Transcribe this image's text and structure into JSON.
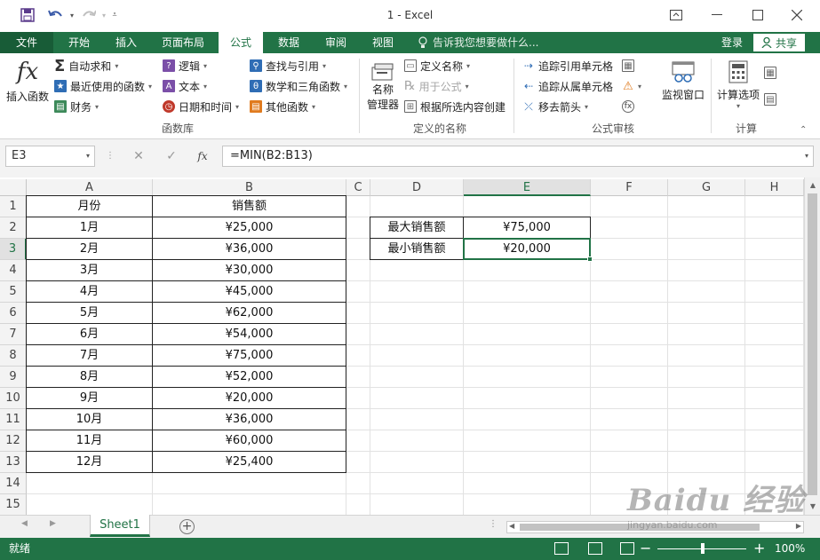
{
  "window": {
    "title": "1 - Excel",
    "controls": [
      "restore-ribbon",
      "minimize",
      "maximize",
      "close"
    ]
  },
  "tabs": [
    {
      "label": "文件",
      "active": false
    },
    {
      "label": "开始",
      "active": false
    },
    {
      "label": "插入",
      "active": false
    },
    {
      "label": "页面布局",
      "active": false
    },
    {
      "label": "公式",
      "active": true
    },
    {
      "label": "数据",
      "active": false
    },
    {
      "label": "审阅",
      "active": false
    },
    {
      "label": "视图",
      "active": false
    }
  ],
  "tell_me": "告诉我您想要做什么...",
  "login": "登录",
  "share": "共享",
  "ribbon": {
    "insert_function": "插入函数",
    "autosum": "自动求和",
    "recent": "最近使用的函数",
    "financial": "财务",
    "logical": "逻辑",
    "text": "文本",
    "datetime": "日期和时间",
    "lookup": "查找与引用",
    "math": "数学和三角函数",
    "other": "其他函数",
    "group_library": "函数库",
    "name_manager_1": "名称",
    "name_manager_2": "管理器",
    "define_name": "定义名称",
    "use_in_formula": "用于公式",
    "create_from_sel": "根据所选内容创建",
    "group_names": "定义的名称",
    "trace_precedents": "追踪引用单元格",
    "trace_dependents": "追踪从属单元格",
    "remove_arrows": "移去箭头",
    "watch_window": "监视窗口",
    "group_audit": "公式审核",
    "calc_options": "计算选项",
    "group_calc": "计算"
  },
  "formula_bar": {
    "name_box": "E3",
    "formula": "=MIN(B2:B13)",
    "fx": "fx"
  },
  "columns": [
    "A",
    "B",
    "C",
    "D",
    "E",
    "F",
    "G",
    "H"
  ],
  "rows": [
    "1",
    "2",
    "3",
    "4",
    "5",
    "6",
    "7",
    "8",
    "9",
    "10",
    "11",
    "12",
    "13",
    "14",
    "15"
  ],
  "table": {
    "header": [
      "月份",
      "销售额"
    ],
    "rows": [
      [
        "1月",
        "¥25,000"
      ],
      [
        "2月",
        "¥36,000"
      ],
      [
        "3月",
        "¥30,000"
      ],
      [
        "4月",
        "¥45,000"
      ],
      [
        "5月",
        "¥62,000"
      ],
      [
        "6月",
        "¥54,000"
      ],
      [
        "7月",
        "¥75,000"
      ],
      [
        "8月",
        "¥52,000"
      ],
      [
        "9月",
        "¥20,000"
      ],
      [
        "10月",
        "¥36,000"
      ],
      [
        "11月",
        "¥60,000"
      ],
      [
        "12月",
        "¥25,400"
      ]
    ]
  },
  "summary": {
    "max_label": "最大销售额",
    "max_value": "¥75,000",
    "min_label": "最小销售额",
    "min_value": "¥20,000"
  },
  "sheet_tab": "Sheet1",
  "status": {
    "text": "就绪",
    "zoom": "100%"
  },
  "watermark": {
    "brand": "Baidu 经验",
    "url": "jingyan.baidu.com"
  }
}
